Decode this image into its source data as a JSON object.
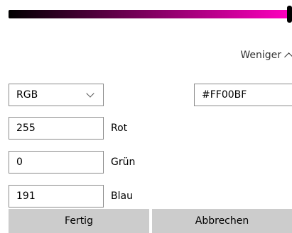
{
  "slider": {
    "gradient_start": "#000000",
    "gradient_end": "#FF00BF",
    "value_fraction": 1.0
  },
  "more_toggle": {
    "label": "Weniger"
  },
  "mode_select": {
    "value": "RGB"
  },
  "hex": {
    "value": "#FF00BF"
  },
  "channels": [
    {
      "value": "255",
      "label": "Rot"
    },
    {
      "value": "0",
      "label": "Grün"
    },
    {
      "value": "191",
      "label": "Blau"
    }
  ],
  "buttons": {
    "ok": "Fertig",
    "cancel": "Abbrechen"
  }
}
